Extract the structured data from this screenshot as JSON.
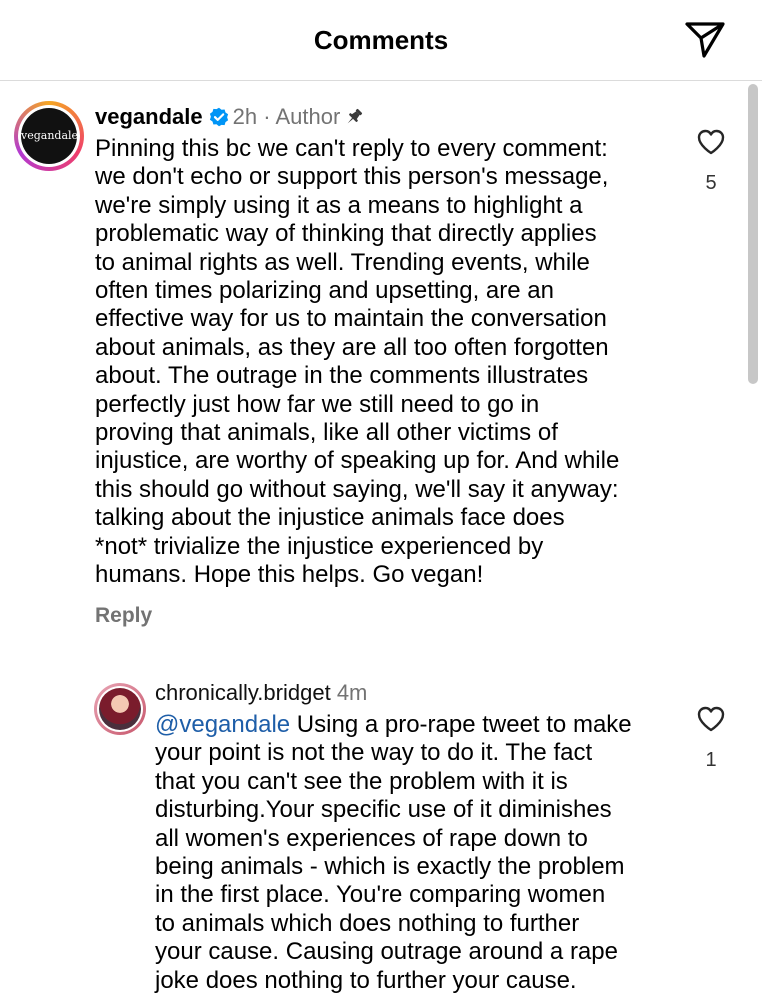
{
  "header": {
    "title": "Comments"
  },
  "comments": [
    {
      "username": "vegandale",
      "avatar_text": "vegandale",
      "time": "2h",
      "separator": "·",
      "badge": "Author",
      "text": "Pinning this bc we can't reply to every comment:\nwe don't echo or support this person's message,\nwe're simply using it as a means to highlight a\nproblematic way of thinking that directly applies\nto animal rights as well. Trending events, while\noften times polarizing and upsetting, are an\neffective way for us to maintain the conversation\nabout animals, as they are all too often forgotten\nabout. The outrage in the comments illustrates\nperfectly just how far we still need to go in\nproving that animals, like all other victims of\ninjustice, are worthy of speaking up for. And while\nthis should go without saying, we'll say it anyway:\ntalking about the injustice animals face does\n*not* trivialize the injustice experienced by\nhumans. Hope this helps. Go vegan!",
      "likes": "5",
      "reply_label": "Reply",
      "icons": [
        "verified-icon",
        "pin-icon",
        "heart-icon"
      ]
    },
    {
      "username": "chronically.bridget",
      "time": "4m",
      "mention": "@vegandale",
      "text": " Using a pro-rape tweet to make\nyour point is not the way to do it. The fact\nthat you can't see the problem with it is\ndisturbing.Your specific use of it diminishes\nall women's experiences of rape down to\nbeing animals - which is exactly the problem\nin the first place. You're comparing women\nto animals which does nothing to further\nyour cause. Causing outrage around a rape\njoke does nothing to further your cause.",
      "likes": "1",
      "icons": [
        "heart-icon"
      ]
    }
  ],
  "colors": {
    "verified": "#0095f6",
    "mention": "#1e5ea8",
    "muted": "#737373"
  },
  "icons": {
    "send": "send-icon"
  }
}
